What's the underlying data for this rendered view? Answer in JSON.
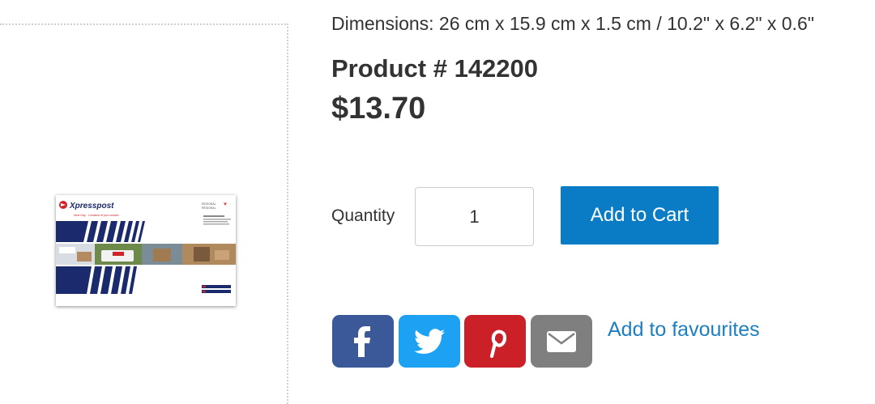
{
  "product": {
    "dimensions": "Dimensions: 26 cm x 15.9 cm x 1.5 cm / 10.2\" x 6.2\" x 0.6\"",
    "product_number": "Product # 142200",
    "price": "$13.70"
  },
  "image": {
    "brand": "Xpresspost",
    "tagline": "Next Day · Livraison le jour suivant",
    "region": "REGIONAL",
    "region_fr": "RÉGIONAL"
  },
  "cart": {
    "quantity_label": "Quantity",
    "quantity_value": "1",
    "add_to_cart_label": "Add to Cart"
  },
  "share": {
    "facebook_icon": "facebook-icon",
    "twitter_icon": "twitter-icon",
    "pinterest_icon": "pinterest-icon",
    "email_icon": "email-icon",
    "colors": {
      "facebook": "#3b5998",
      "twitter": "#1da1f2",
      "pinterest": "#cb2027",
      "email": "#7f7f7f"
    }
  },
  "favourites": {
    "label": "Add to favourites"
  },
  "colors": {
    "accent": "#0a7cc5",
    "link": "#1c7fc0",
    "text": "#333333"
  }
}
